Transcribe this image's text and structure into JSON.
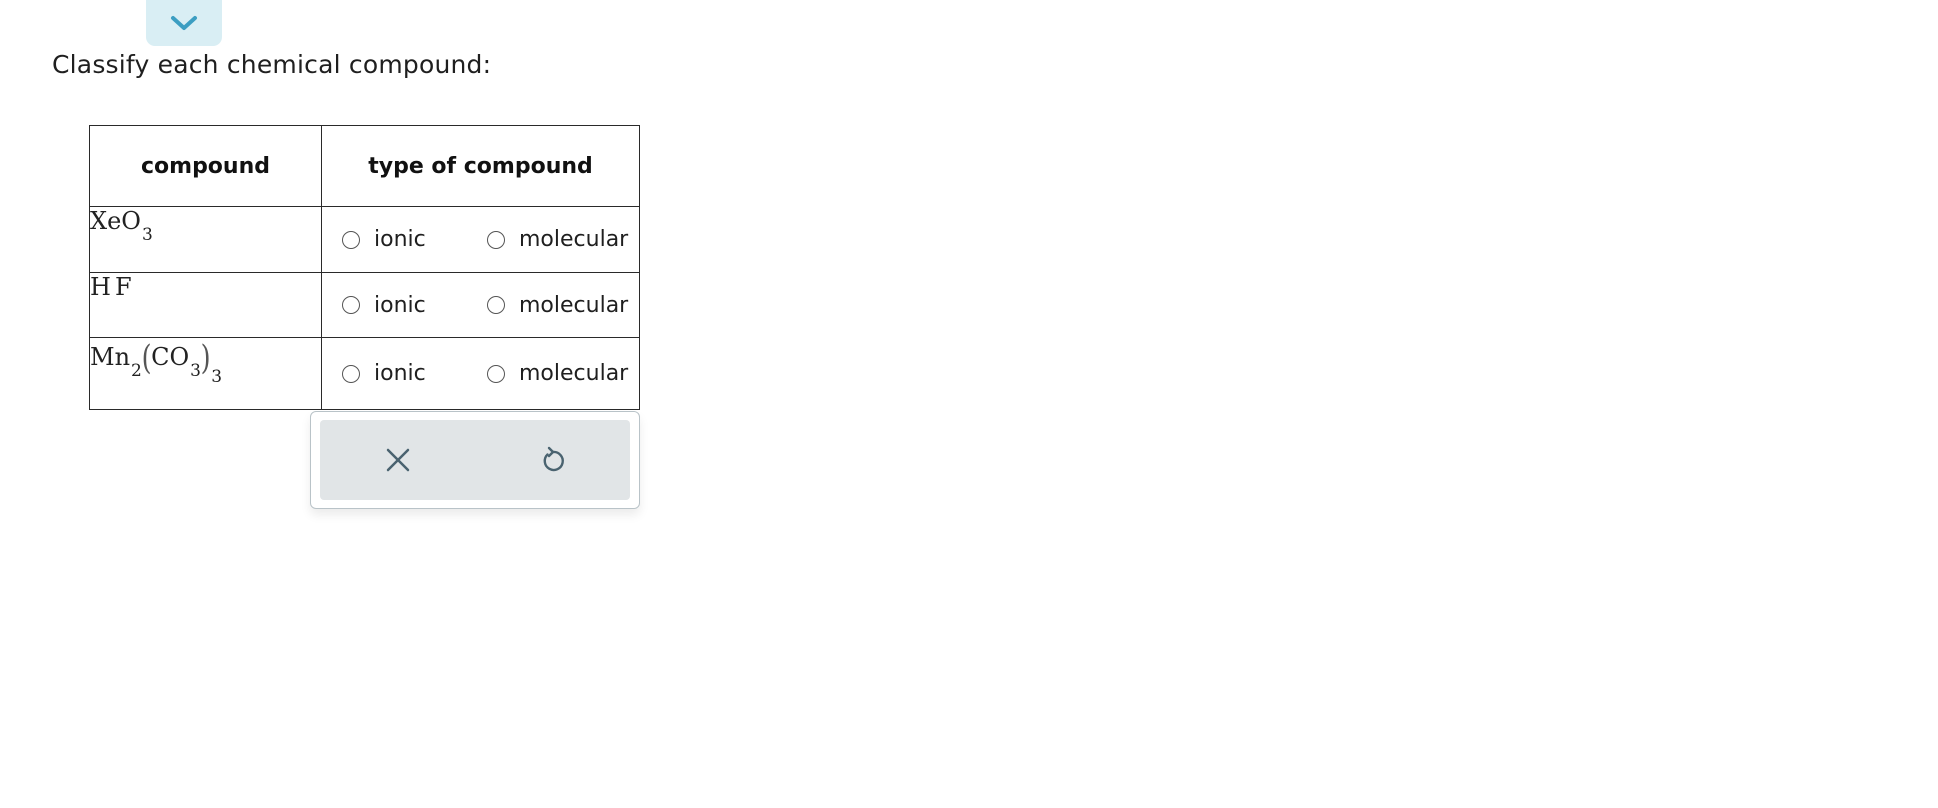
{
  "prompt": "Classify each chemical compound:",
  "table": {
    "headers": [
      "compound",
      "type of compound"
    ],
    "rows": [
      {
        "formula_parts": [
          "XeO",
          "3"
        ],
        "options": [
          "ionic",
          "molecular"
        ]
      },
      {
        "formula_parts": [
          "H",
          "F"
        ],
        "options": [
          "ionic",
          "molecular"
        ]
      },
      {
        "formula_parts": [
          "Mn",
          "2",
          "(",
          "CO",
          "3",
          ")",
          "3"
        ],
        "options": [
          "ionic",
          "molecular"
        ]
      }
    ]
  },
  "icons": {
    "collapse": "chevron-down-icon",
    "clear": "close-icon",
    "reset": "undo-icon"
  },
  "colors": {
    "tab_bg": "#d9eef4",
    "chevron": "#3c9ec2",
    "panel_bg": "#e1e5e7",
    "icon": "#4a6370"
  }
}
